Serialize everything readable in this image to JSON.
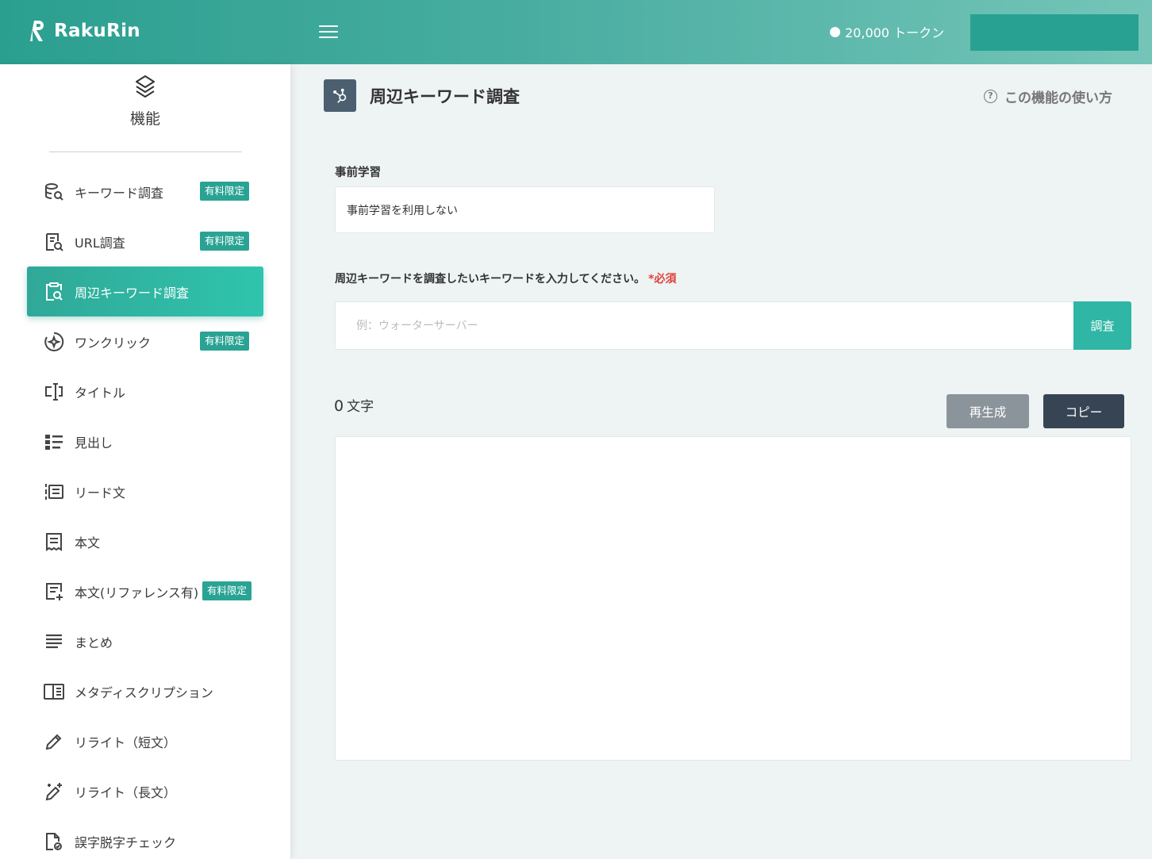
{
  "header": {
    "logo_text": "RakuRin",
    "tokens": "20,000 トークン",
    "account_button_label": ""
  },
  "sidebar": {
    "title": "機能",
    "items": [
      {
        "label": "キーワード調査",
        "badge": "有料限定",
        "icon": "keyword-search-icon"
      },
      {
        "label": "URL調査",
        "badge": "有料限定",
        "icon": "url-search-icon"
      },
      {
        "label": "周辺キーワード調査",
        "badge": "",
        "icon": "clipboard-search-icon",
        "active": true
      },
      {
        "label": "ワンクリック",
        "badge": "有料限定",
        "icon": "sparkle-circle-icon"
      },
      {
        "label": "タイトル",
        "badge": "",
        "icon": "title-cursor-icon"
      },
      {
        "label": "見出し",
        "badge": "",
        "icon": "heading-list-icon"
      },
      {
        "label": "リード文",
        "badge": "",
        "icon": "lead-text-icon"
      },
      {
        "label": "本文",
        "badge": "",
        "icon": "receipt-text-icon"
      },
      {
        "label": "本文(リファレンス有)",
        "badge": "有料限定",
        "icon": "document-plus-icon"
      },
      {
        "label": "まとめ",
        "badge": "",
        "icon": "lines-icon"
      },
      {
        "label": "メタディスクリプション",
        "badge": "",
        "icon": "panel-book-icon"
      },
      {
        "label": "リライト（短文）",
        "badge": "",
        "icon": "pencil-icon"
      },
      {
        "label": "リライト（長文）",
        "badge": "",
        "icon": "magic-pencil-icon"
      },
      {
        "label": "誤字脱字チェック",
        "badge": "",
        "icon": "document-check-icon"
      }
    ]
  },
  "main": {
    "page_title": "周辺キーワード調査",
    "help_label": "この機能の使い方",
    "prelearning_label": "事前学習",
    "prelearning_value": "事前学習を利用しない",
    "keyword_label": "周辺キーワードを調査したいキーワードを入力してください。",
    "required_mark": "*必須",
    "keyword_placeholder": "例：ウォーターサーバー",
    "search_button": "調査",
    "char_count": "0",
    "char_unit": "文字",
    "regenerate_button": "再生成",
    "copy_button": "コピー"
  },
  "colors": {
    "accent": "#2fb6a4",
    "header_start": "#2a9f90",
    "header_end": "#74c5b8",
    "dark_button": "#364454",
    "required": "#e0413a"
  }
}
